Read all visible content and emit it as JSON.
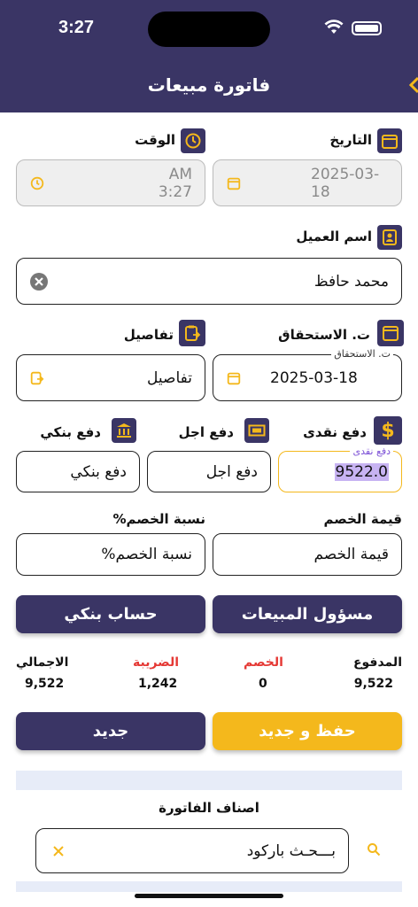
{
  "status": {
    "time": "3:27"
  },
  "header": {
    "title": "فاتورة مبيعات"
  },
  "fields": {
    "date_label": "التاريخ",
    "date_value": "2025-03-18",
    "time_label": "الوقت",
    "time_value": "AM 3:27",
    "customer_label": "اسم العميل",
    "customer_value": "محمد حافظ",
    "due_label": "ت. الاستحقاق",
    "due_float_label": "ت. الاستحقاق",
    "due_value": "2025-03-18",
    "details_label": "تفاصيل",
    "details_placeholder": "تفاصيل",
    "cash_label": "دفع نقدى",
    "cash_float_label": "دفع نقدى",
    "cash_value": "9522.0",
    "deferred_label": "دفع اجل",
    "deferred_placeholder": "دفع اجل",
    "bank_label": "دفع بنكي",
    "bank_placeholder": "دفع بنكي",
    "discount_value_label": "قيمة الخصم",
    "discount_value_placeholder": "قيمة الخصم",
    "discount_pct_label": "نسبة الخصم%",
    "discount_pct_placeholder": "نسبة الخصم%"
  },
  "buttons": {
    "sales_rep": "مسؤول المبيعات",
    "bank_account": "حساب بنكي",
    "save_new": "حفظ و جديد",
    "new": "جديد"
  },
  "summary": {
    "paid_label": "المدفوع",
    "paid_value": "9,522",
    "discount_label": "الخصم",
    "discount_value": "0",
    "tax_label": "الضريبة",
    "tax_value": "1,242",
    "total_label": "الاجمالي",
    "total_value": "9,522"
  },
  "items": {
    "section_title": "اصناف الفاتورة",
    "search_value": "بـــحـث  باركود"
  },
  "colors": {
    "primary": "#3a3565",
    "accent": "#f4b81c",
    "danger": "#e53935"
  }
}
